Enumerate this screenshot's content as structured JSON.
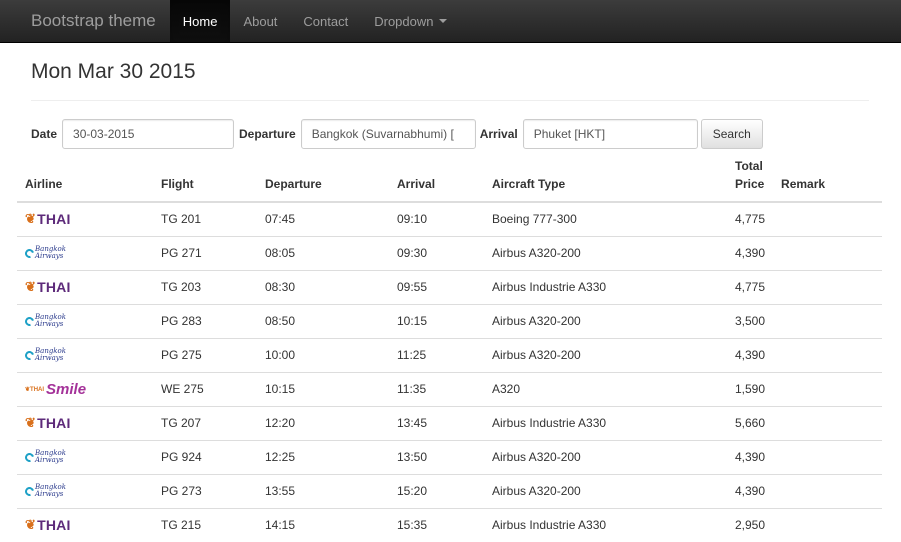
{
  "navbar": {
    "brand": "Bootstrap theme",
    "items": [
      {
        "label": "Home",
        "active": true
      },
      {
        "label": "About",
        "active": false
      },
      {
        "label": "Contact",
        "active": false
      },
      {
        "label": "Dropdown",
        "active": false
      }
    ]
  },
  "page": {
    "title": "Mon Mar 30 2015"
  },
  "search_form": {
    "date_label": "Date",
    "date_value": "30-03-2015",
    "departure_label": "Departure",
    "departure_value": "Bangkok (Suvarnabhumi) [",
    "arrival_label": "Arrival",
    "arrival_value": "Phuket [HKT]",
    "search_button": "Search"
  },
  "table": {
    "headers": {
      "airline": "Airline",
      "flight": "Flight",
      "departure": "Departure",
      "arrival": "Arrival",
      "aircraft": "Aircraft Type",
      "price_line1": "Total",
      "price_line2": "Price",
      "remark": "Remark"
    },
    "rows": [
      {
        "airline": "thai-logo",
        "logo_text": "THAI",
        "flight": "TG 201",
        "departure": "07:45",
        "arrival": "09:10",
        "aircraft": "Boeing 777-300",
        "price": "4,775",
        "remark": ""
      },
      {
        "airline": "bangkok-airways-logo",
        "logo_text": "Bangkok Airways",
        "flight": "PG 271",
        "departure": "08:05",
        "arrival": "09:30",
        "aircraft": "Airbus A320-200",
        "price": "4,390",
        "remark": ""
      },
      {
        "airline": "thai-logo",
        "logo_text": "THAI",
        "flight": "TG 203",
        "departure": "08:30",
        "arrival": "09:55",
        "aircraft": "Airbus Industrie A330",
        "price": "4,775",
        "remark": ""
      },
      {
        "airline": "bangkok-airways-logo",
        "logo_text": "Bangkok Airways",
        "flight": "PG 283",
        "departure": "08:50",
        "arrival": "10:15",
        "aircraft": "Airbus A320-200",
        "price": "3,500",
        "remark": ""
      },
      {
        "airline": "bangkok-airways-logo",
        "logo_text": "Bangkok Airways",
        "flight": "PG 275",
        "departure": "10:00",
        "arrival": "11:25",
        "aircraft": "Airbus A320-200",
        "price": "4,390",
        "remark": ""
      },
      {
        "airline": "thai-smile-logo",
        "logo_text": "Smile",
        "flight": "WE 275",
        "departure": "10:15",
        "arrival": "11:35",
        "aircraft": "A320",
        "price": "1,590",
        "remark": ""
      },
      {
        "airline": "thai-logo",
        "logo_text": "THAI",
        "flight": "TG 207",
        "departure": "12:20",
        "arrival": "13:45",
        "aircraft": "Airbus Industrie A330",
        "price": "5,660",
        "remark": ""
      },
      {
        "airline": "bangkok-airways-logo",
        "logo_text": "Bangkok Airways",
        "flight": "PG 924",
        "departure": "12:25",
        "arrival": "13:50",
        "aircraft": "Airbus A320-200",
        "price": "4,390",
        "remark": ""
      },
      {
        "airline": "bangkok-airways-logo",
        "logo_text": "Bangkok Airways",
        "flight": "PG 273",
        "departure": "13:55",
        "arrival": "15:20",
        "aircraft": "Airbus A320-200",
        "price": "4,390",
        "remark": ""
      },
      {
        "airline": "thai-logo",
        "logo_text": "THAI",
        "flight": "TG 215",
        "departure": "14:15",
        "arrival": "15:35",
        "aircraft": "Airbus Industrie A330",
        "price": "2,950",
        "remark": ""
      }
    ]
  }
}
